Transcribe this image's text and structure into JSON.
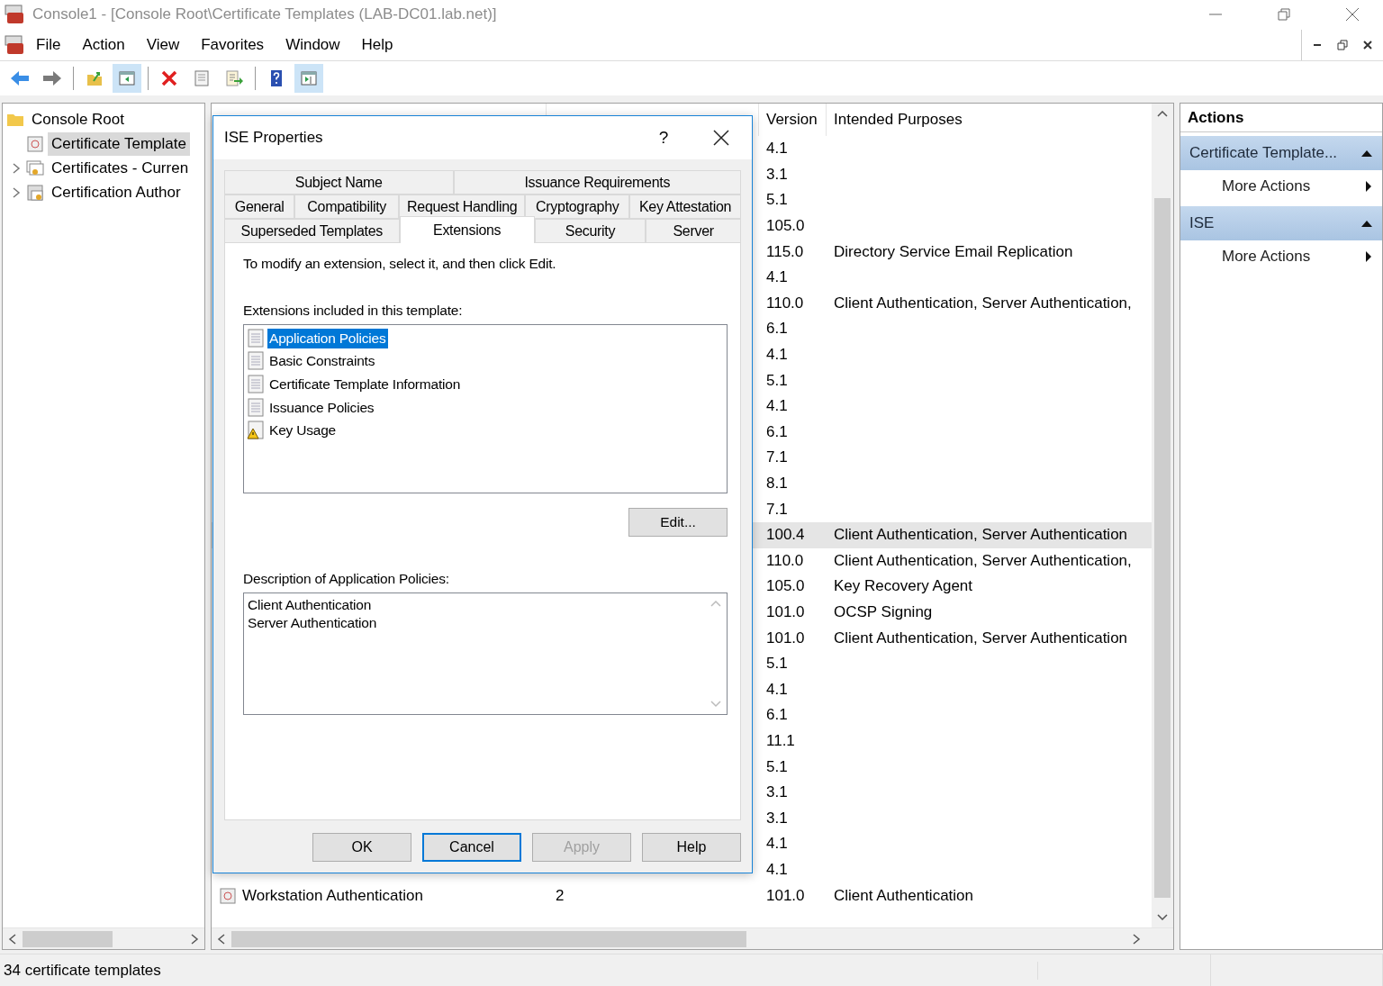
{
  "window": {
    "title": "Console1 - [Console Root\\Certificate Templates (LAB-DC01.lab.net)]"
  },
  "menu": [
    "File",
    "Action",
    "View",
    "Favorites",
    "Window",
    "Help"
  ],
  "toolbar": [
    {
      "kind": "back",
      "pressed": false
    },
    {
      "kind": "forward",
      "pressed": false
    },
    {
      "kind": "sep"
    },
    {
      "kind": "up",
      "pressed": false
    },
    {
      "kind": "tree",
      "pressed": true
    },
    {
      "kind": "sep"
    },
    {
      "kind": "delete",
      "pressed": false
    },
    {
      "kind": "properties",
      "pressed": false
    },
    {
      "kind": "export",
      "pressed": false
    },
    {
      "kind": "sep"
    },
    {
      "kind": "help",
      "pressed": false
    },
    {
      "kind": "actionpane",
      "pressed": true
    }
  ],
  "tree": [
    {
      "label": "Console Root",
      "selected": false,
      "children": [
        {
          "label": "Certificate Template",
          "selected": true,
          "expandable": false
        },
        {
          "label": "Certificates - Curren",
          "selected": false,
          "expandable": true
        },
        {
          "label": "Certification Author",
          "selected": false,
          "expandable": true
        }
      ]
    }
  ],
  "list": {
    "columns": [
      "Version",
      "Intended Purposes"
    ],
    "rows": [
      {
        "version": "4.1",
        "selected": false
      },
      {
        "version": "3.1",
        "selected": false
      },
      {
        "version": "5.1",
        "selected": false
      },
      {
        "version": "105.0",
        "selected": false
      },
      {
        "version": "115.0",
        "purposes": "Directory Service Email Replication",
        "selected": false
      },
      {
        "version": "4.1",
        "selected": false
      },
      {
        "version": "110.0",
        "purposes": "Client Authentication, Server Authentication,",
        "selected": false
      },
      {
        "version": "6.1",
        "selected": false
      },
      {
        "version": "4.1",
        "selected": false
      },
      {
        "version": "5.1",
        "selected": false
      },
      {
        "version": "4.1",
        "selected": false
      },
      {
        "version": "6.1",
        "selected": false
      },
      {
        "version": "7.1",
        "selected": false
      },
      {
        "version": "8.1",
        "selected": false
      },
      {
        "version": "7.1",
        "selected": false
      },
      {
        "version": "100.4",
        "purposes": "Client Authentication, Server Authentication",
        "selected": true
      },
      {
        "version": "110.0",
        "purposes": "Client Authentication, Server Authentication,",
        "selected": false
      },
      {
        "version": "105.0",
        "purposes": "Key Recovery Agent",
        "selected": false
      },
      {
        "version": "101.0",
        "purposes": "OCSP Signing",
        "selected": false
      },
      {
        "version": "101.0",
        "purposes": "Client Authentication, Server Authentication",
        "selected": false
      },
      {
        "version": "5.1",
        "selected": false
      },
      {
        "version": "4.1",
        "selected": false
      },
      {
        "version": "6.1",
        "selected": false
      },
      {
        "version": "11.1",
        "selected": false
      },
      {
        "version": "5.1",
        "selected": false
      },
      {
        "version": "3.1",
        "selected": false
      },
      {
        "version": "3.1",
        "selected": false
      },
      {
        "version": "4.1",
        "selected": false
      },
      {
        "version": "4.1",
        "selected": false
      },
      {
        "name": "Workstation Authentication",
        "schema": "2",
        "version": "101.0",
        "purposes": "Client Authentication",
        "selected": false
      }
    ]
  },
  "actions": {
    "title": "Actions",
    "sections": [
      {
        "title": "Certificate Template...",
        "expanded": true,
        "items": [
          "More Actions"
        ]
      },
      {
        "title": "ISE",
        "expanded": true,
        "items": [
          "More Actions"
        ]
      }
    ]
  },
  "dialog": {
    "title": "ISE Properties",
    "help": "?",
    "tab_rows": [
      [
        {
          "label": "Subject Name",
          "selected": false
        },
        {
          "label": "Issuance Requirements",
          "selected": false
        }
      ],
      [
        {
          "label": "General",
          "selected": false
        },
        {
          "label": "Compatibility",
          "selected": false
        },
        {
          "label": "Request Handling",
          "selected": false
        },
        {
          "label": "Cryptography",
          "selected": false
        },
        {
          "label": "Key Attestation",
          "selected": false
        }
      ],
      [
        {
          "label": "Superseded Templates",
          "selected": false
        },
        {
          "label": "Extensions",
          "selected": true
        },
        {
          "label": "Security",
          "selected": false
        },
        {
          "label": "Server",
          "selected": false
        }
      ]
    ],
    "instruction": "To modify an extension, select it, and then click Edit.",
    "extensions_label": "Extensions included in this template:",
    "extensions": [
      {
        "label": "Application Policies",
        "selected": true,
        "critical": false
      },
      {
        "label": "Basic Constraints",
        "selected": false,
        "critical": false
      },
      {
        "label": "Certificate Template Information",
        "selected": false,
        "critical": false
      },
      {
        "label": "Issuance Policies",
        "selected": false,
        "critical": false
      },
      {
        "label": "Key Usage",
        "selected": false,
        "critical": true
      }
    ],
    "edit_button": "Edit...",
    "description_label": "Description of Application Policies:",
    "description": [
      "Client Authentication",
      "Server Authentication"
    ],
    "buttons": [
      {
        "label": "OK",
        "default": false,
        "disabled": false
      },
      {
        "label": "Cancel",
        "default": true,
        "disabled": false
      },
      {
        "label": "Apply",
        "default": false,
        "disabled": true
      },
      {
        "label": "Help",
        "default": false,
        "disabled": false
      }
    ]
  },
  "status_bar": "34 certificate templates"
}
